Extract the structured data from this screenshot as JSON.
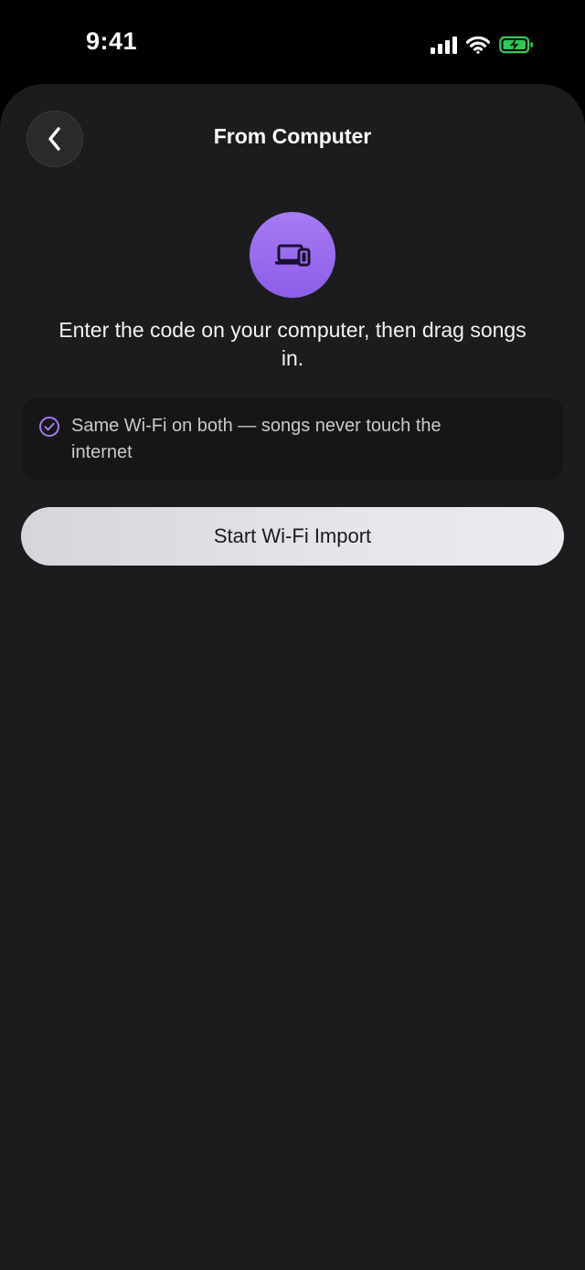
{
  "status_bar": {
    "time": "9:41",
    "icons": [
      "cellular-signal-icon",
      "wifi-icon",
      "battery-charging-icon"
    ],
    "battery_color": "#34c759"
  },
  "header": {
    "back_icon": "chevron-left-icon",
    "title": "From Computer"
  },
  "hero": {
    "icon": "laptop-phone-icon",
    "accent_color": "#9966ee"
  },
  "instruction": "Enter the code on your computer, then drag songs in.",
  "info": {
    "icon": "check-circle-icon",
    "text": "Same Wi-Fi on both — songs never touch the internet"
  },
  "actions": {
    "start_label": "Start Wi-Fi Import"
  }
}
